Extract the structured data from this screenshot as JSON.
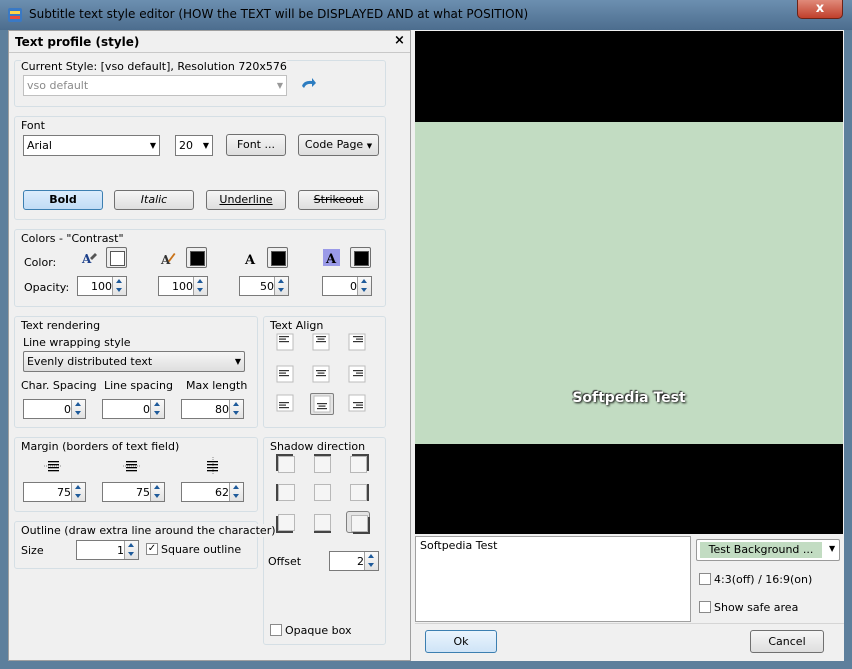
{
  "window": {
    "title": "Subtitle text style editor  (HOW the TEXT will be DISPLAYED AND at what POSITION)",
    "close_label": "x"
  },
  "panel": {
    "title": "Text profile (style)",
    "close_label": "×"
  },
  "current_style": {
    "label": "Current Style: [vso default], Resolution 720x576",
    "value": "vso default"
  },
  "font": {
    "group_label": "Font",
    "name": "Arial",
    "size": "20",
    "font_button": "Font ...",
    "codepage_button": "Code Page",
    "styles": {
      "bold": "Bold",
      "italic": "Italic",
      "underline": "Underline",
      "strikeout": "Strikeout"
    }
  },
  "colors": {
    "group_label": "Colors - \"Contrast\"",
    "color_label": "Color:",
    "opacity_label": "Opacity:",
    "opacities": [
      "100",
      "100",
      "50",
      "0"
    ],
    "swatch_colors": [
      "#ffffff",
      "#000000",
      "#000000",
      "#000000"
    ]
  },
  "text_rendering": {
    "group_label": "Text rendering",
    "wrap_label": "Line wrapping style",
    "wrap_value": "Evenly distributed text",
    "char_spacing_label": "Char. Spacing",
    "line_spacing_label": "Line spacing",
    "max_length_label": "Max length",
    "char_spacing": "0",
    "line_spacing": "0",
    "max_length": "80"
  },
  "text_align": {
    "group_label": "Text Align"
  },
  "margin": {
    "group_label": "Margin  (borders of text field)",
    "values": [
      "75",
      "75",
      "62"
    ]
  },
  "shadow": {
    "group_label": "Shadow direction",
    "offset_label": "Offset",
    "offset": "2",
    "opaque_label": "Opaque box"
  },
  "outline": {
    "group_label": "Outline  (draw extra line around the character)",
    "size_label": "Size",
    "size": "1",
    "square_label": "Square outline"
  },
  "preview": {
    "text": "Softpedia Test",
    "input_text": "Softpedia Test",
    "background_button": "Test Background ...",
    "aspect_label": "4:3(off) / 16:9(on)",
    "safe_area_label": "Show safe area"
  },
  "footer": {
    "ok": "Ok",
    "cancel": "Cancel"
  },
  "accent_colors": {
    "preview_bg": "#000000",
    "preview_area": "#c2dcc2",
    "test_bg_button": "#c2dcc2"
  }
}
